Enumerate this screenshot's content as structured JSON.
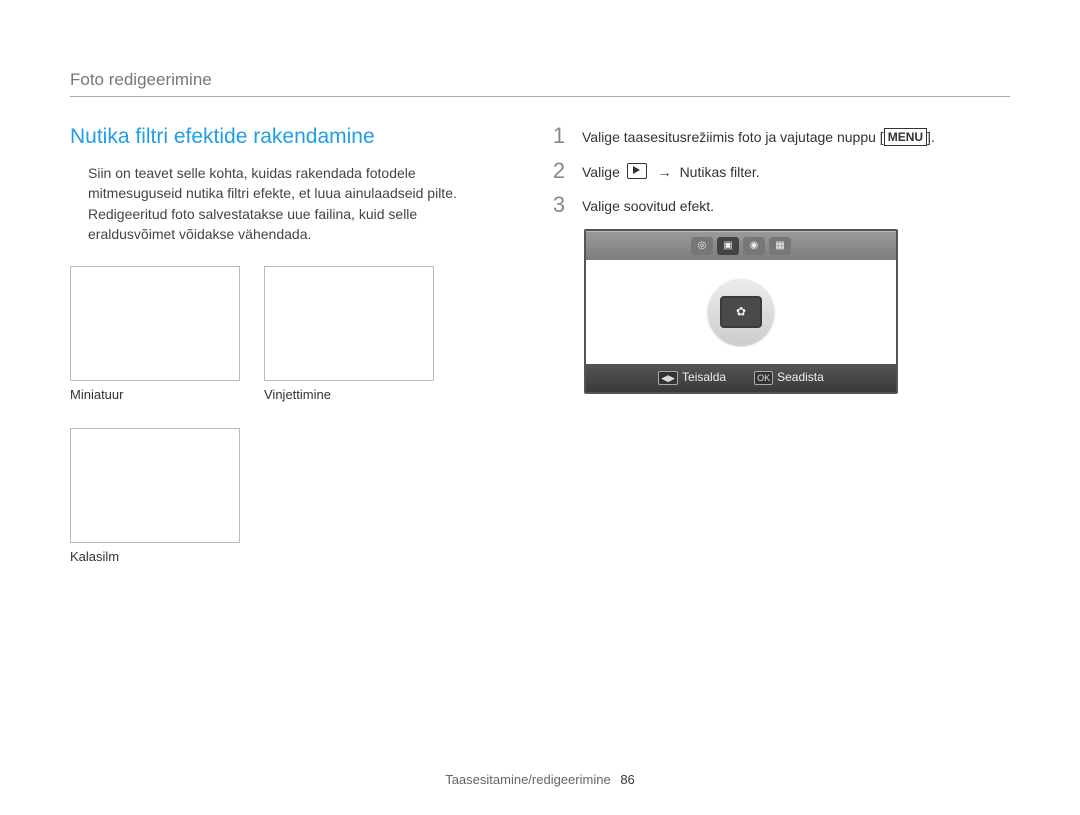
{
  "header": {
    "title": "Foto redigeerimine"
  },
  "section": {
    "title": "Nutika ﬁltri efektide rakendamine",
    "body": "Siin on teavet selle kohta, kuidas rakendada fotodele mitmesuguseid nutika ﬁltri efekte, et luua ainulaadseid pilte. Redigeeritud foto salvestatakse uue failina, kuid selle eraldusvõimet võidakse vähendada."
  },
  "thumbs": [
    {
      "label": "Miniatuur"
    },
    {
      "label": "Vinjettimine"
    },
    {
      "label": "Kalasilm"
    }
  ],
  "steps": [
    {
      "num": "1",
      "text_before": "Valige taasesitusrežiimis foto ja vajutage nuppu [",
      "button": "MENU",
      "text_after": "]."
    },
    {
      "num": "2",
      "prefix": "Valige ",
      "arrow": "→",
      "suffix": "Nutikas ﬁlter."
    },
    {
      "num": "3",
      "text": "Valige soovitud efekt."
    }
  ],
  "lcd": {
    "bottom": {
      "left_key": "◀▶",
      "left_label": "Teisalda",
      "right_key": "OK",
      "right_label": "Seadista"
    }
  },
  "footer": {
    "section": "Taasesitamine/redigeerimine",
    "page": "86"
  }
}
